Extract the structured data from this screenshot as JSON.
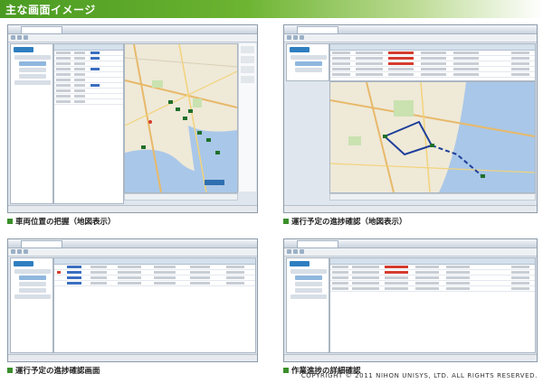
{
  "header": {
    "title": "主な画面イメージ"
  },
  "captions": [
    "車両位置の把握（地図表示）",
    "運行予定の進捗確認（地図表示）",
    "運行予定の進捗確認画面",
    "作業進捗の詳細確認"
  ],
  "copyright": "COPYRIGHT © 2011 NIHON UNISYS, LTD. ALL RIGHTS RESERVED.",
  "colors": {
    "header_green": "#4a9a22",
    "caption_square": "#3a8f2a",
    "route_line": "#1f3f9a",
    "alert_red": "#d43c2e"
  }
}
